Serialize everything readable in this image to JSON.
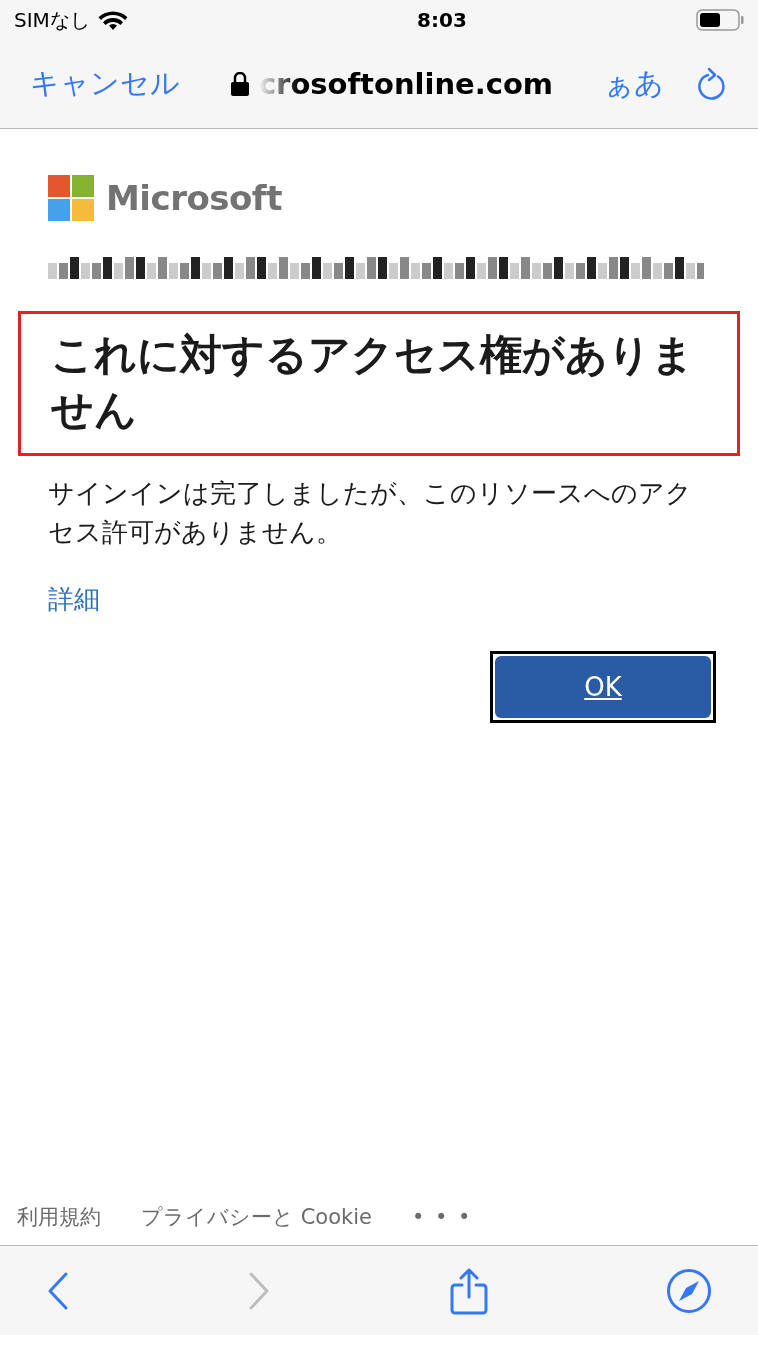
{
  "status_bar": {
    "carrier": "SIMなし",
    "time": "8:03"
  },
  "nav_bar": {
    "cancel": "キャンセル",
    "address": "crosoftonline.com",
    "text_size": "ぁあ"
  },
  "page": {
    "brand": "Microsoft",
    "heading": "これに対するアクセス権がありません",
    "message": "サインインは完了しましたが、このリソースへのアクセス許可がありません。",
    "details_link": "詳細",
    "ok_button": "OK",
    "footer_links": [
      "利用規約",
      "プライバシーと Cookie"
    ],
    "footer_more": "• • •"
  },
  "toolbar": {
    "back_disabled": false,
    "forward_disabled": true
  }
}
